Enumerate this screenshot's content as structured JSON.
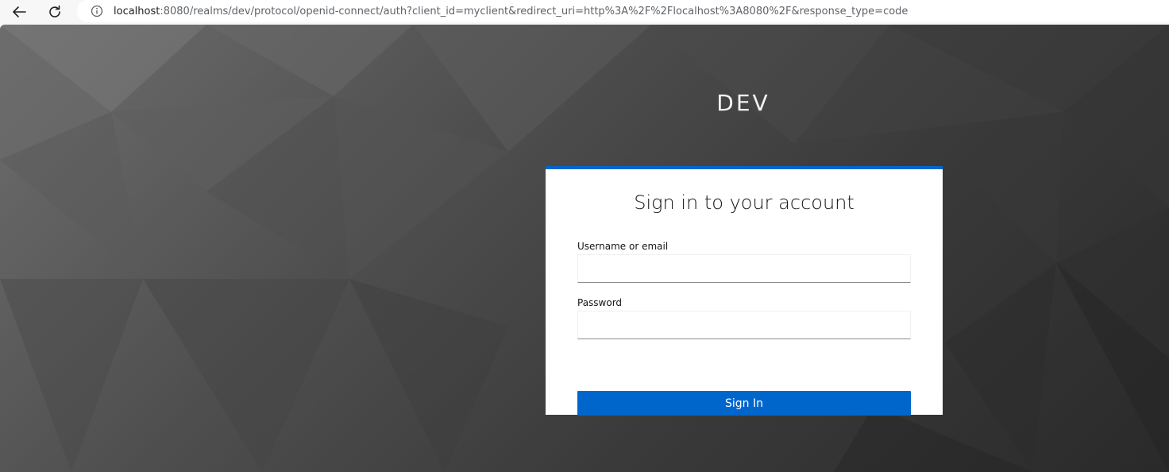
{
  "browser": {
    "url_host": "localhost",
    "url_rest": ":8080/realms/dev/protocol/openid-connect/auth?client_id=myclient&redirect_uri=http%3A%2F%2Flocalhost%3A8080%2F&response_type=code",
    "icons": {
      "back": "arrow-left-icon",
      "reload": "reload-icon",
      "info": "info-icon"
    }
  },
  "page": {
    "realm_name": "DEV",
    "card": {
      "title": "Sign in to your account",
      "username_label": "Username or email",
      "username_value": "",
      "password_label": "Password",
      "password_value": "",
      "submit_label": "Sign In"
    }
  },
  "colors": {
    "accent": "#0066cc",
    "background_light": "#6e6e6e",
    "background_dark": "#2a2a2a",
    "card": "#ffffff"
  }
}
